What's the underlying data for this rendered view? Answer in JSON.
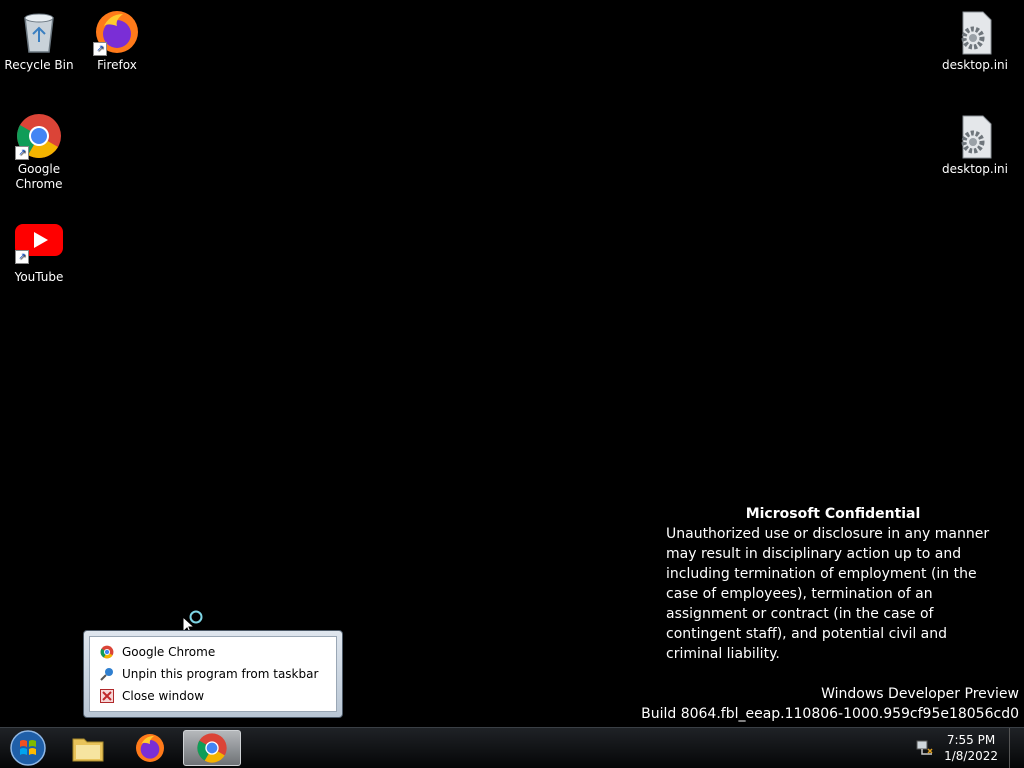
{
  "desktop": {
    "icons": [
      {
        "label": "Recycle Bin"
      },
      {
        "label": "Firefox"
      },
      {
        "label": "Google Chrome"
      },
      {
        "label": "YouTube"
      },
      {
        "label": "desktop.ini"
      },
      {
        "label": "desktop.ini"
      }
    ]
  },
  "watermark": {
    "title": "Microsoft Confidential",
    "body": "Unauthorized use or disclosure in any manner may result in disciplinary action up to and including termination of employment (in the case of employees), termination of an assignment or contract (in the case of contingent staff), and potential civil and criminal liability.",
    "edition": "Windows Developer Preview",
    "build": "Build 8064.fbl_eeap.110806-1000.959cf95e18056cd0"
  },
  "jumplist": {
    "items": [
      {
        "label": "Google Chrome",
        "icon": "chrome-icon"
      },
      {
        "label": "Unpin this program from taskbar",
        "icon": "unpin-icon"
      },
      {
        "label": "Close window",
        "icon": "close-window-icon"
      }
    ]
  },
  "taskbar": {
    "clock": {
      "time": "7:55 PM",
      "date": "1/8/2022"
    }
  },
  "colors": {
    "accent": "#1a55c9",
    "chrome_red": "#db4437",
    "chrome_green": "#0f9d58",
    "chrome_yellow": "#f4b400",
    "chrome_blue": "#4285f4"
  }
}
